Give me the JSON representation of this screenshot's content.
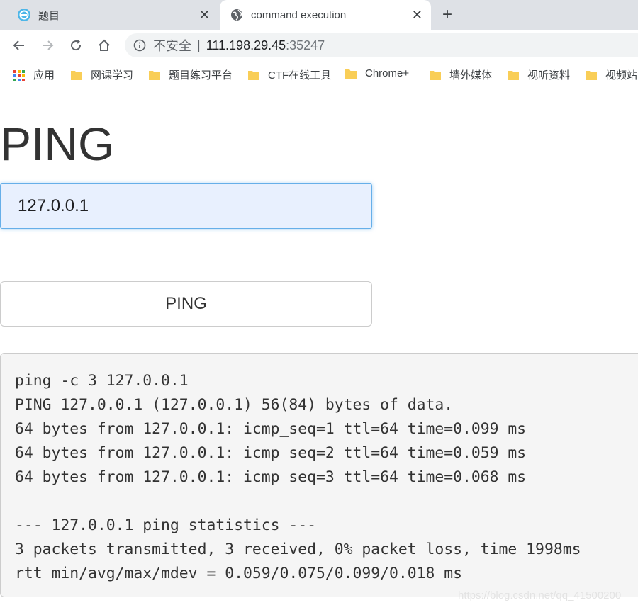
{
  "browser": {
    "tabs": [
      {
        "title": "题目",
        "active": false
      },
      {
        "title": "command execution",
        "active": true
      }
    ],
    "omnibox": {
      "security_label": "不安全",
      "divider": "|",
      "host": "111.198.29.45",
      "port": ":35247"
    },
    "bookmarks": [
      {
        "label": "应用",
        "icon": "apps-grid-icon"
      },
      {
        "label": "网课学习",
        "icon": "folder-icon"
      },
      {
        "label": "题目练习平台",
        "icon": "folder-icon"
      },
      {
        "label": "CTF在线工具",
        "icon": "folder-icon"
      },
      {
        "label": "Chrome+",
        "icon": "folder-icon"
      },
      {
        "label": "墙外媒体",
        "icon": "folder-icon"
      },
      {
        "label": "视听资料",
        "icon": "folder-icon"
      },
      {
        "label": "视频站",
        "icon": "folder-icon"
      }
    ]
  },
  "page": {
    "title": "PING",
    "ip_input_value": "127.0.0.1",
    "ping_button_label": "PING",
    "output_lines": [
      "ping -c 3 127.0.0.1",
      "PING 127.0.0.1 (127.0.0.1) 56(84) bytes of data.",
      "64 bytes from 127.0.0.1: icmp_seq=1 ttl=64 time=0.099 ms",
      "64 bytes from 127.0.0.1: icmp_seq=2 ttl=64 time=0.059 ms",
      "64 bytes from 127.0.0.1: icmp_seq=3 ttl=64 time=0.068 ms",
      "",
      "--- 127.0.0.1 ping statistics ---",
      "3 packets transmitted, 3 received, 0% packet loss, time 1998ms",
      "rtt min/avg/max/mdev = 0.059/0.075/0.099/0.018 ms"
    ],
    "watermark": "https://blog.csdn.net/qq_41500200"
  },
  "colors": {
    "tabstrip": "#dee1e6",
    "input_focus_border": "#66afe9",
    "input_autofill_bg": "#e8f0fe",
    "output_bg": "#f5f5f5"
  }
}
